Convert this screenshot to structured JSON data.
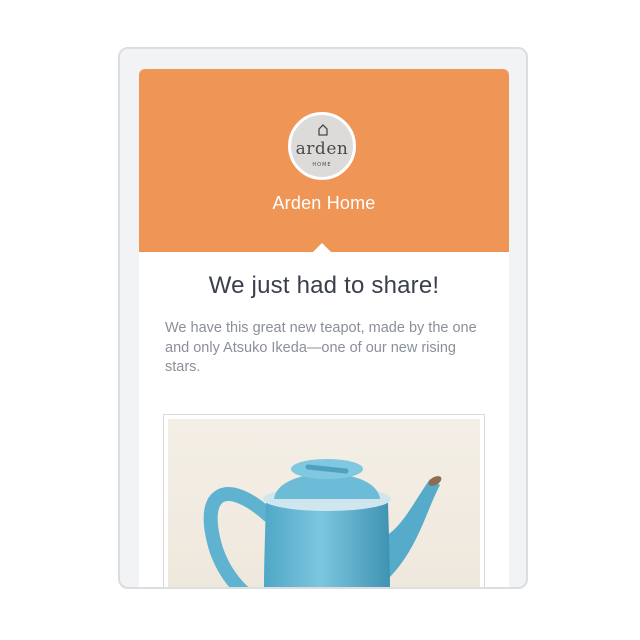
{
  "brand": {
    "logo_word": "arden",
    "logo_sub": "HOME",
    "name": "Arden Home",
    "header_color": "#ef9555"
  },
  "email": {
    "headline": "We just had to share!",
    "body": "We have this great new teapot, made by the one and only Atsuko Ikeda—one of our new rising stars."
  },
  "icons": {
    "logo_icon": "house-icon",
    "photo": "teapot-photo"
  }
}
